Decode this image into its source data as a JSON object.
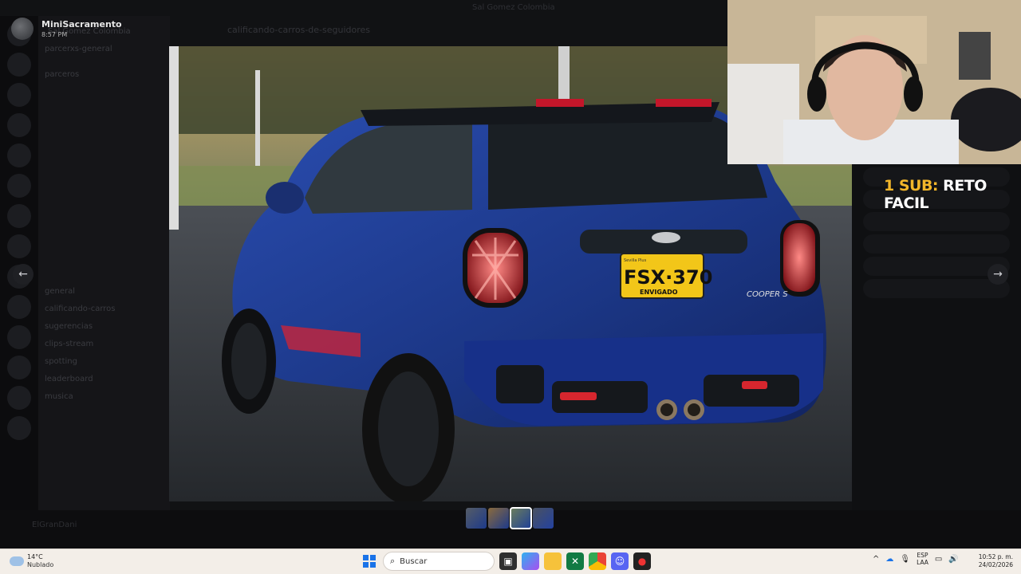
{
  "background": {
    "window_title": "Sal Gomez Colombia",
    "server_name": "Sal Gomez Colombia",
    "channel_header": "calificando-carros-de-seguidores",
    "channels": [
      "parcerxs-general",
      "parceros",
      "general",
      "calificando-carros",
      "sugerencias",
      "clips-stream",
      "spotting",
      "leaderboard",
      "musica"
    ],
    "user_name": "ElGranDani"
  },
  "viewer": {
    "poster_name": "MiniSacramento",
    "post_time": "8:57 PM",
    "prev_icon": "arrow-left-icon",
    "next_icon": "arrow-right-icon",
    "prev_glyph": "←",
    "next_glyph": "→",
    "image_subject": "FSX·370",
    "plate_top": "Sevilla Plus",
    "plate_bottom": "ENVIGADO",
    "badge": "COOPER S",
    "thumbnail_count": 4
  },
  "overlay": {
    "sub_goal_prefix": "1 SUB:",
    "sub_goal_text": " RETO FACIL"
  },
  "taskbar": {
    "temperature": "14°C",
    "condition": "Nublado",
    "search_placeholder": "Buscar",
    "lang_top": "ESP",
    "lang_bottom": "LAA",
    "time": "10:52 p. m.",
    "date": "24/02/2026",
    "tray_chevron": "^"
  },
  "colors": {
    "accent_gold": "#f2b62a",
    "car_blue": "#1e3f99",
    "taskbar_bg": "#f3eee8"
  }
}
